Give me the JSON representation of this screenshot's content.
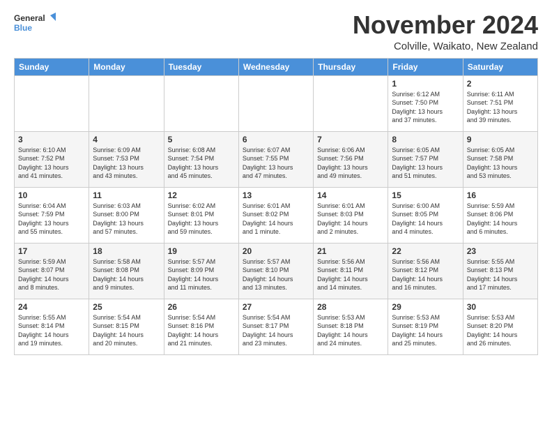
{
  "logo": {
    "line1": "General",
    "line2": "Blue"
  },
  "title": "November 2024",
  "subtitle": "Colville, Waikato, New Zealand",
  "weekdays": [
    "Sunday",
    "Monday",
    "Tuesday",
    "Wednesday",
    "Thursday",
    "Friday",
    "Saturday"
  ],
  "weeks": [
    [
      {
        "day": "",
        "info": ""
      },
      {
        "day": "",
        "info": ""
      },
      {
        "day": "",
        "info": ""
      },
      {
        "day": "",
        "info": ""
      },
      {
        "day": "",
        "info": ""
      },
      {
        "day": "1",
        "info": "Sunrise: 6:12 AM\nSunset: 7:50 PM\nDaylight: 13 hours\nand 37 minutes."
      },
      {
        "day": "2",
        "info": "Sunrise: 6:11 AM\nSunset: 7:51 PM\nDaylight: 13 hours\nand 39 minutes."
      }
    ],
    [
      {
        "day": "3",
        "info": "Sunrise: 6:10 AM\nSunset: 7:52 PM\nDaylight: 13 hours\nand 41 minutes."
      },
      {
        "day": "4",
        "info": "Sunrise: 6:09 AM\nSunset: 7:53 PM\nDaylight: 13 hours\nand 43 minutes."
      },
      {
        "day": "5",
        "info": "Sunrise: 6:08 AM\nSunset: 7:54 PM\nDaylight: 13 hours\nand 45 minutes."
      },
      {
        "day": "6",
        "info": "Sunrise: 6:07 AM\nSunset: 7:55 PM\nDaylight: 13 hours\nand 47 minutes."
      },
      {
        "day": "7",
        "info": "Sunrise: 6:06 AM\nSunset: 7:56 PM\nDaylight: 13 hours\nand 49 minutes."
      },
      {
        "day": "8",
        "info": "Sunrise: 6:05 AM\nSunset: 7:57 PM\nDaylight: 13 hours\nand 51 minutes."
      },
      {
        "day": "9",
        "info": "Sunrise: 6:05 AM\nSunset: 7:58 PM\nDaylight: 13 hours\nand 53 minutes."
      }
    ],
    [
      {
        "day": "10",
        "info": "Sunrise: 6:04 AM\nSunset: 7:59 PM\nDaylight: 13 hours\nand 55 minutes."
      },
      {
        "day": "11",
        "info": "Sunrise: 6:03 AM\nSunset: 8:00 PM\nDaylight: 13 hours\nand 57 minutes."
      },
      {
        "day": "12",
        "info": "Sunrise: 6:02 AM\nSunset: 8:01 PM\nDaylight: 13 hours\nand 59 minutes."
      },
      {
        "day": "13",
        "info": "Sunrise: 6:01 AM\nSunset: 8:02 PM\nDaylight: 14 hours\nand 1 minute."
      },
      {
        "day": "14",
        "info": "Sunrise: 6:01 AM\nSunset: 8:03 PM\nDaylight: 14 hours\nand 2 minutes."
      },
      {
        "day": "15",
        "info": "Sunrise: 6:00 AM\nSunset: 8:05 PM\nDaylight: 14 hours\nand 4 minutes."
      },
      {
        "day": "16",
        "info": "Sunrise: 5:59 AM\nSunset: 8:06 PM\nDaylight: 14 hours\nand 6 minutes."
      }
    ],
    [
      {
        "day": "17",
        "info": "Sunrise: 5:59 AM\nSunset: 8:07 PM\nDaylight: 14 hours\nand 8 minutes."
      },
      {
        "day": "18",
        "info": "Sunrise: 5:58 AM\nSunset: 8:08 PM\nDaylight: 14 hours\nand 9 minutes."
      },
      {
        "day": "19",
        "info": "Sunrise: 5:57 AM\nSunset: 8:09 PM\nDaylight: 14 hours\nand 11 minutes."
      },
      {
        "day": "20",
        "info": "Sunrise: 5:57 AM\nSunset: 8:10 PM\nDaylight: 14 hours\nand 13 minutes."
      },
      {
        "day": "21",
        "info": "Sunrise: 5:56 AM\nSunset: 8:11 PM\nDaylight: 14 hours\nand 14 minutes."
      },
      {
        "day": "22",
        "info": "Sunrise: 5:56 AM\nSunset: 8:12 PM\nDaylight: 14 hours\nand 16 minutes."
      },
      {
        "day": "23",
        "info": "Sunrise: 5:55 AM\nSunset: 8:13 PM\nDaylight: 14 hours\nand 17 minutes."
      }
    ],
    [
      {
        "day": "24",
        "info": "Sunrise: 5:55 AM\nSunset: 8:14 PM\nDaylight: 14 hours\nand 19 minutes."
      },
      {
        "day": "25",
        "info": "Sunrise: 5:54 AM\nSunset: 8:15 PM\nDaylight: 14 hours\nand 20 minutes."
      },
      {
        "day": "26",
        "info": "Sunrise: 5:54 AM\nSunset: 8:16 PM\nDaylight: 14 hours\nand 21 minutes."
      },
      {
        "day": "27",
        "info": "Sunrise: 5:54 AM\nSunset: 8:17 PM\nDaylight: 14 hours\nand 23 minutes."
      },
      {
        "day": "28",
        "info": "Sunrise: 5:53 AM\nSunset: 8:18 PM\nDaylight: 14 hours\nand 24 minutes."
      },
      {
        "day": "29",
        "info": "Sunrise: 5:53 AM\nSunset: 8:19 PM\nDaylight: 14 hours\nand 25 minutes."
      },
      {
        "day": "30",
        "info": "Sunrise: 5:53 AM\nSunset: 8:20 PM\nDaylight: 14 hours\nand 26 minutes."
      }
    ]
  ]
}
